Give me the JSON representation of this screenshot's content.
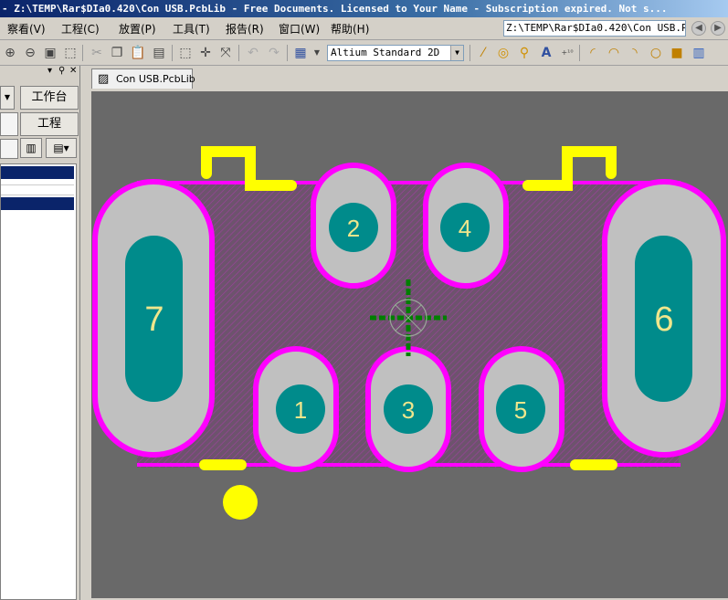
{
  "window": {
    "title": "- Z:\\TEMP\\Rar$DIa0.420\\Con USB.PcbLib - Free Documents. Licensed to Your Name - Subscription expired. Not s..."
  },
  "menu": {
    "items": [
      {
        "label": "察看(V)"
      },
      {
        "label": "工程(C)"
      },
      {
        "label": "放置(P)"
      },
      {
        "label": "工具(T)"
      },
      {
        "label": "报告(R)"
      },
      {
        "label": "窗口(W)"
      },
      {
        "label": "帮助(H)"
      }
    ],
    "path_value": "Z:\\TEMP\\Rar$DIa0.420\\Con USB.Pc"
  },
  "toolbar": {
    "view_mode": "Altium Standard 2D"
  },
  "left_panel": {
    "workspace_label": "工作台",
    "project_label": "工程"
  },
  "document": {
    "tab_label": "Con USB.PcbLib"
  },
  "pcb": {
    "pads": [
      {
        "label": "1"
      },
      {
        "label": "2"
      },
      {
        "label": "3"
      },
      {
        "label": "4"
      },
      {
        "label": "5"
      },
      {
        "label": "6"
      },
      {
        "label": "7"
      }
    ],
    "colors": {
      "background": "#696969",
      "pad_copper": "#c0c0c0",
      "drill": "#008b8b",
      "solder_mask": "#ff00ff",
      "silkscreen": "#ffff00",
      "pad_number": "#f0e68c",
      "origin_marker": "#007f00"
    }
  }
}
